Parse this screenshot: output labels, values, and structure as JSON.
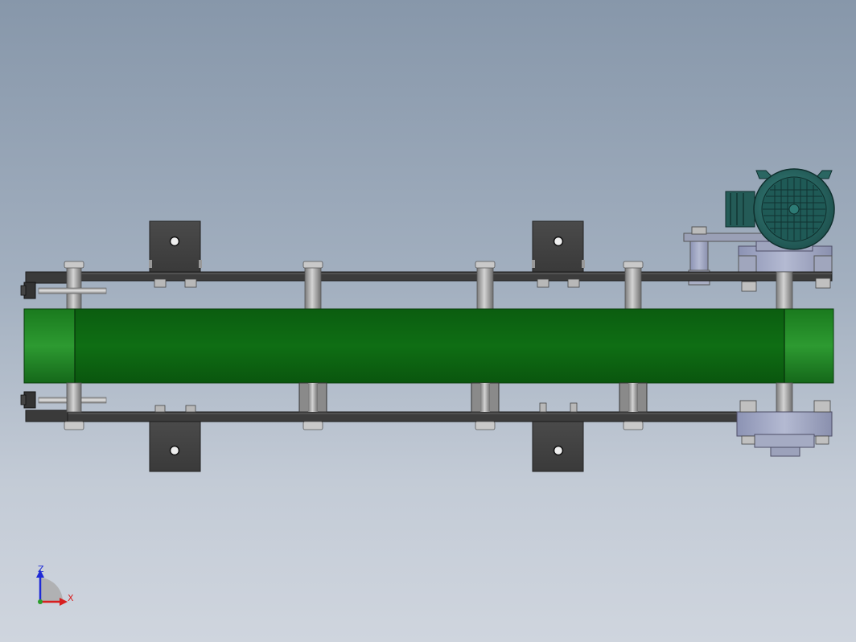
{
  "model": {
    "belt_color": "#0e6b12",
    "frame_color": "#3c3c3c",
    "motor_color": "#2c6e6a",
    "background_top": "#8797aa",
    "background_bottom": "#cfd5de"
  },
  "triad": {
    "z_label": "Z",
    "x_label": "X",
    "z_color": "#1f2bd6",
    "x_color": "#d81f1f"
  }
}
